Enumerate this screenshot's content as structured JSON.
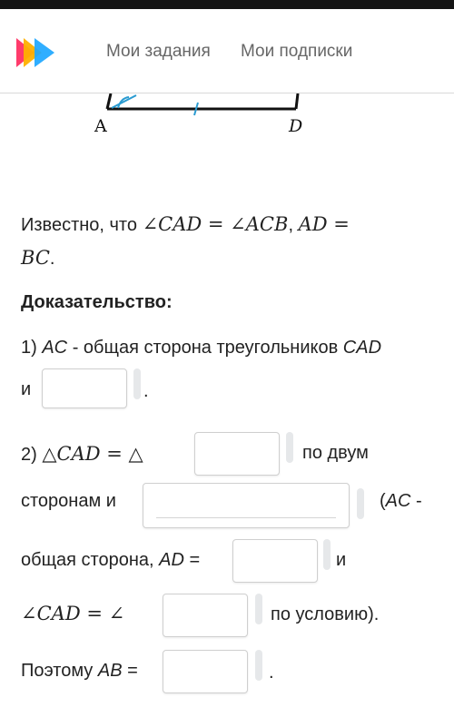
{
  "header": {
    "nav": [
      "Мои задания",
      "Мои подписки"
    ]
  },
  "figure": {
    "label_a": "A",
    "label_d": "D"
  },
  "problem": {
    "given_prefix": "Известно, что",
    "given_math1": "∠CAD = ∠ACB",
    "given_sep": ",",
    "given_math2": "AD =",
    "given_math3": "BC",
    "given_end": ".",
    "proof_title": "Доказательство:",
    "step1_text": "1) ",
    "step1_ac": "AC",
    "step1_mid": " - общая сторона треугольников ",
    "step1_cad": "CAD",
    "step1_and": "и",
    "step1_end": ".",
    "step2_num": "2)",
    "step2_math": "△CAD = △",
    "step2_after": "по двум",
    "step2_line2": "сторонам и",
    "step2_paren": "(",
    "step2_ac": "AC",
    "step2_dash": " -",
    "step2_line3": "общая сторона, ",
    "step2_ad": "AD",
    "step2_eq": " =",
    "step2_and": "и",
    "step2_angle": "∠CAD = ∠",
    "step2_cond": "по условию).",
    "therefore": "Поэтому ",
    "therefore_ab": "AB",
    "therefore_eq": " =",
    "therefore_end": "."
  }
}
